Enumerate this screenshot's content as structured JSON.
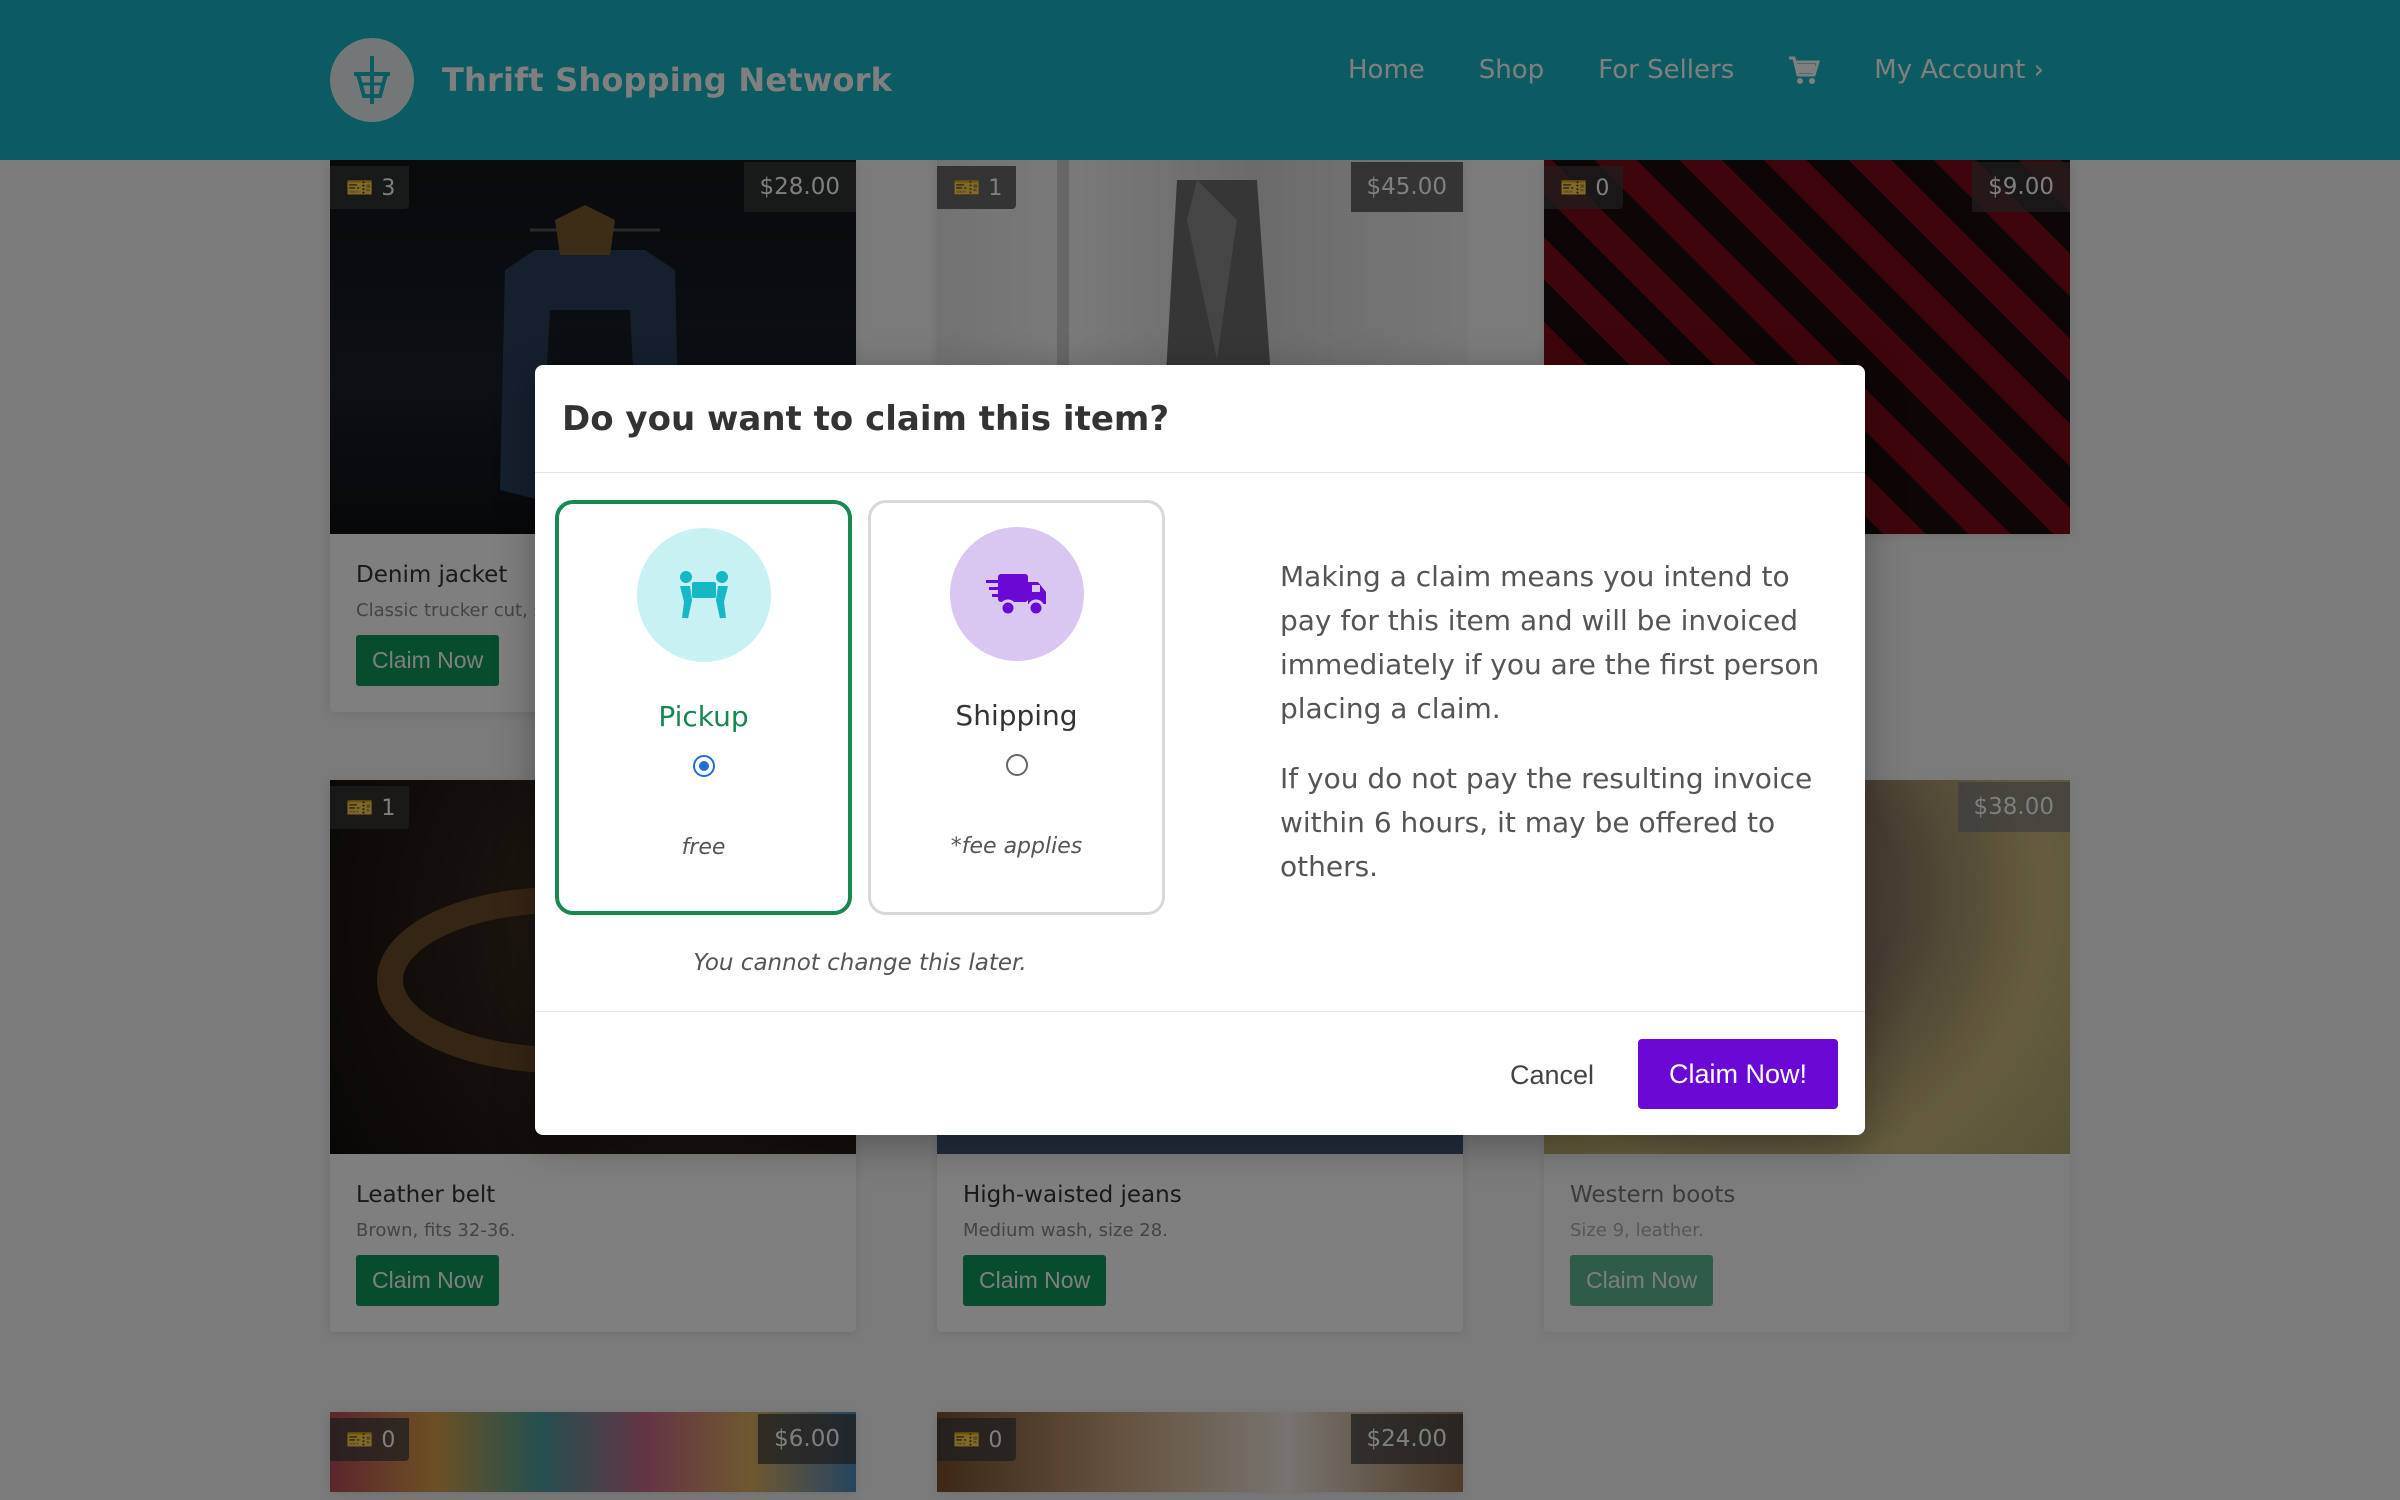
{
  "header": {
    "brand": "Thrift Shopping Network",
    "nav": [
      "Home",
      "Shop",
      "For Sellers"
    ],
    "account": "My Account ›"
  },
  "products": [
    {
      "title": "Denim jacket",
      "desc": "Classic trucker cut, size M.",
      "price": "$28.00",
      "qty": "3",
      "button": "Claim Now"
    },
    {
      "title": "",
      "desc": "",
      "price": "$45.00",
      "qty": "1",
      "button": "Claim Now"
    },
    {
      "title": "",
      "desc": "",
      "price": "$9.00",
      "qty": "0",
      "button": "Claim Now"
    },
    {
      "title": "Leather belt",
      "desc": "Brown, fits 32-36.",
      "price": "",
      "qty": "1",
      "button": "Claim Now"
    },
    {
      "title": "High-waisted jeans",
      "desc": "Medium wash, size 28.",
      "price": "",
      "qty": "",
      "button": "Claim Now"
    },
    {
      "title": "Western boots",
      "desc": "Size 9, leather.",
      "price": "$38.00",
      "qty": "",
      "button": "Claim Now"
    },
    {
      "title": "",
      "desc": "",
      "price": "$6.00",
      "qty": "0",
      "button": ""
    },
    {
      "title": "",
      "desc": "",
      "price": "$24.00",
      "qty": "0",
      "button": ""
    }
  ],
  "modal": {
    "title": "Do you want to claim this item?",
    "options": [
      {
        "label": "Pickup",
        "note": "free",
        "selected": true
      },
      {
        "label": "Shipping",
        "note": "*fee applies",
        "selected": false
      }
    ],
    "warning": "You cannot change this later.",
    "info": [
      "Making a claim means you intend to pay for this item and will be invoiced immediately if you are the first person placing a claim.",
      "If you do not pay the resulting invoice within 6 hours, it may be offered to others."
    ],
    "cancel": "Cancel",
    "confirm": "Claim Now!"
  },
  "colors": {
    "header": "#1ab7c4",
    "claim_green": "#0f9a5a",
    "pickup_green": "#17894f",
    "confirm_purple": "#6a08d6"
  }
}
